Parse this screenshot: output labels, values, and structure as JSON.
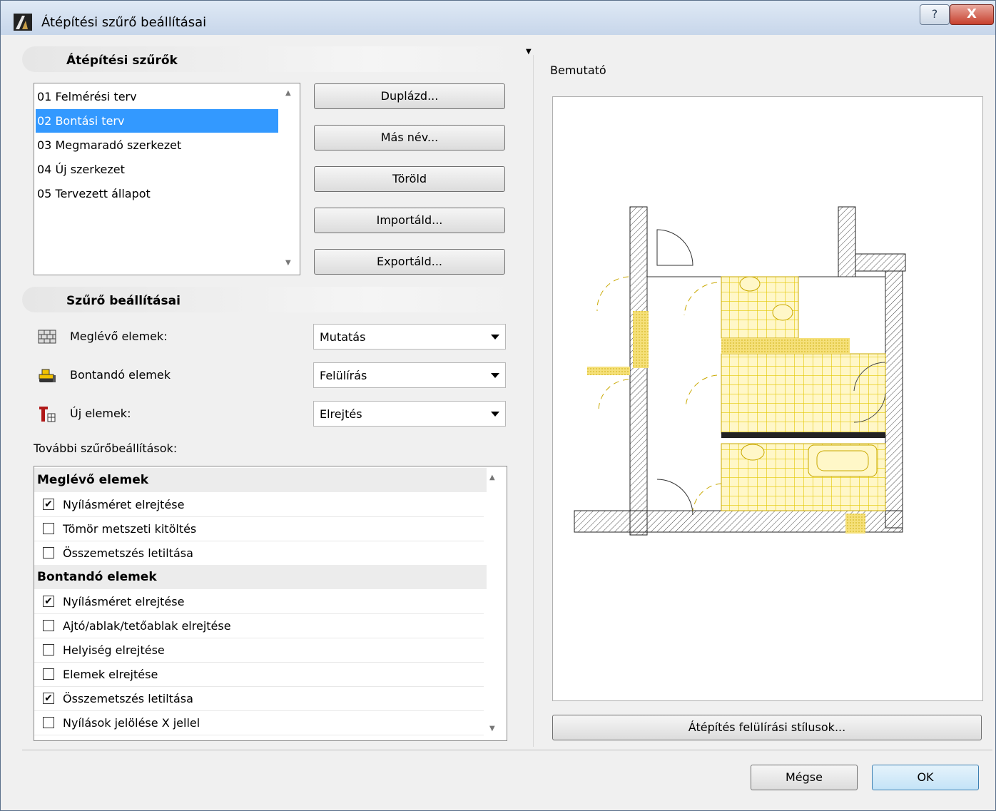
{
  "window": {
    "title": "Átépítési szűrő beállításai",
    "help_glyph": "?",
    "close_glyph": "X"
  },
  "filters": {
    "header": "Átépítési szűrők",
    "items": [
      {
        "label": "01 Felmérési terv",
        "selected": false
      },
      {
        "label": "02 Bontási terv",
        "selected": true
      },
      {
        "label": "03 Megmaradó szerkezet",
        "selected": false
      },
      {
        "label": "04 Új szerkezet",
        "selected": false
      },
      {
        "label": "05 Tervezett állapot",
        "selected": false
      }
    ],
    "buttons": {
      "duplicate": "Duplázd...",
      "rename": "Más név...",
      "delete": "Töröld",
      "import": "Importáld...",
      "export": "Exportáld..."
    }
  },
  "settings": {
    "header": "Szűrő beállításai",
    "existing": {
      "label": "Meglévő elemek:",
      "value": "Mutatás",
      "icon": "brick-wall-icon"
    },
    "demolished": {
      "label": "Bontandó elemek",
      "value": "Felülírás",
      "icon": "bulldozer-icon"
    },
    "new": {
      "label": "Új elemek:",
      "value": "Elrejtés",
      "icon": "crane-icon"
    }
  },
  "more_options": {
    "label": "További szűrőbeállítások:",
    "groups": [
      {
        "title": "Meglévő elemek",
        "items": [
          {
            "label": "Nyílásméret elrejtése",
            "checked": true
          },
          {
            "label": "Tömör metszeti kitöltés",
            "checked": false
          },
          {
            "label": "Összemetszés letiltása",
            "checked": false
          }
        ]
      },
      {
        "title": "Bontandó elemek",
        "items": [
          {
            "label": "Nyílásméret elrejtése",
            "checked": true
          },
          {
            "label": "Ajtó/ablak/tetőablak elrejtése",
            "checked": false
          },
          {
            "label": "Helyiség elrejtése",
            "checked": false
          },
          {
            "label": "Elemek elrejtése",
            "checked": false
          },
          {
            "label": "Összemetszés letiltása",
            "checked": true
          },
          {
            "label": "Nyílások jelölése X jellel",
            "checked": false
          }
        ]
      }
    ]
  },
  "preview": {
    "label": "Bemutató",
    "override_button": "Átépítés felülírási stílusok...",
    "colors": {
      "wall": "#333333",
      "demolish": "#f5d800",
      "fill": "#fff3b0"
    }
  },
  "footer": {
    "cancel": "Mégse",
    "ok": "OK"
  }
}
